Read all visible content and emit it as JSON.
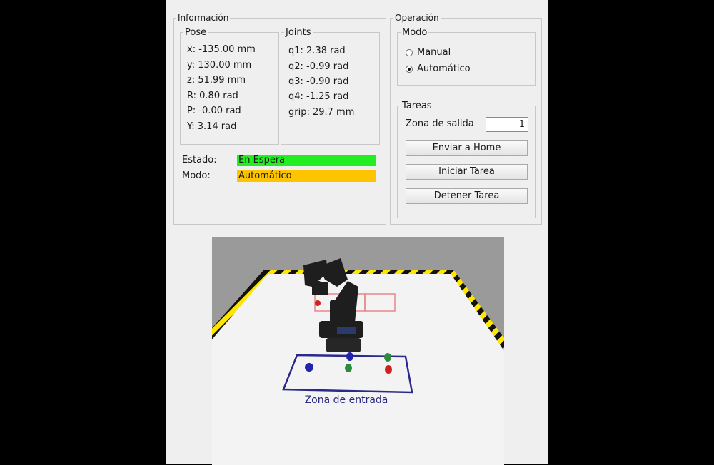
{
  "informacion": {
    "legend": "Información",
    "pose": {
      "legend": "Pose",
      "items": [
        "x: -135.00 mm",
        "y: 130.00 mm",
        "z: 51.99 mm",
        "R: 0.80 rad",
        "P: -0.00 rad",
        "Y: 3.14 rad"
      ]
    },
    "joints": {
      "legend": "Joints",
      "items": [
        "q1: 2.38 rad",
        "q2: -0.99 rad",
        "q3: -0.90 rad",
        "q4: -1.25 rad",
        "grip: 29.7 mm"
      ]
    },
    "estado": {
      "label": "Estado:",
      "value": "En Espera",
      "color": "#22ee22"
    },
    "modo": {
      "label": "Modo:",
      "value": "Automático",
      "color": "#ffc400"
    }
  },
  "operacion": {
    "legend": "Operación",
    "modo": {
      "legend": "Modo",
      "options": [
        {
          "label": "Manual",
          "checked": false
        },
        {
          "label": "Automático",
          "checked": true
        }
      ]
    },
    "tareas": {
      "legend": "Tareas",
      "zona_label": "Zona de salida",
      "zona_value": "1",
      "buttons": [
        "Enviar a Home",
        "Iniciar Tarea",
        "Detener Tarea"
      ]
    }
  },
  "scene": {
    "input_zone_label": "Zona de entrada",
    "colors": {
      "floor": "#f3f3f3",
      "background": "#9a9a9a",
      "hazard_yellow": "#ffe600",
      "zone_blue": "#2a2a8a",
      "output_zone_red": "#e35a5a"
    }
  }
}
